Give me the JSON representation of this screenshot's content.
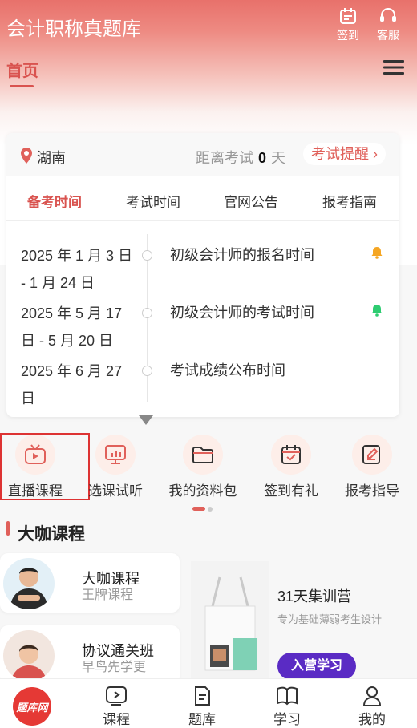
{
  "header": {
    "title": "会计职称真题库",
    "signin_label": "签到",
    "service_label": "客服"
  },
  "nav": {
    "home_label": "首页"
  },
  "exam_card": {
    "location": "湖南",
    "countdown_prefix": "距离考试",
    "countdown_days": "0",
    "countdown_suffix": "天",
    "remind_label": "考试提醒",
    "tabs": [
      "备考时间",
      "考试时间",
      "官网公告",
      "报考指南"
    ],
    "active_tab": 0,
    "timeline": [
      {
        "date": "2025 年 1 月 3 日 - 1 月 24 日",
        "event": "初级会计师的报名时间",
        "bell": "orange-bell-icon"
      },
      {
        "date": "2025 年 5 月 17 日 - 5 月 20 日",
        "event": "初级会计师的考试时间",
        "bell": "green-bell-icon"
      },
      {
        "date": "2025 年 6 月 27 日",
        "event": "考试成绩公布时间",
        "bell": null
      }
    ]
  },
  "quick_links": [
    {
      "label": "直播课程",
      "icon": "tv-icon"
    },
    {
      "label": "选课试听",
      "icon": "chart-screen-icon"
    },
    {
      "label": "我的资料包",
      "icon": "folder-icon"
    },
    {
      "label": "签到有礼",
      "icon": "calendar-check-icon"
    },
    {
      "label": "报考指导",
      "icon": "edit-doc-icon"
    }
  ],
  "section": {
    "title": "大咖课程"
  },
  "courses": [
    {
      "title": "大咖课程",
      "subtitle": "王牌课程"
    },
    {
      "title": "协议通关班",
      "subtitle": "早鸟先学更"
    }
  ],
  "camp": {
    "title": "31天集训营",
    "subtitle": "专为基础薄弱考生设计",
    "button": "入营学习"
  },
  "tabbar": {
    "logo_text": "题库网",
    "items": [
      "课程",
      "题库",
      "学习",
      "我的"
    ]
  },
  "colors": {
    "accent": "#d9534f",
    "header_gradient_top": "#e8716b",
    "camp_button": "#5a2bc4"
  }
}
